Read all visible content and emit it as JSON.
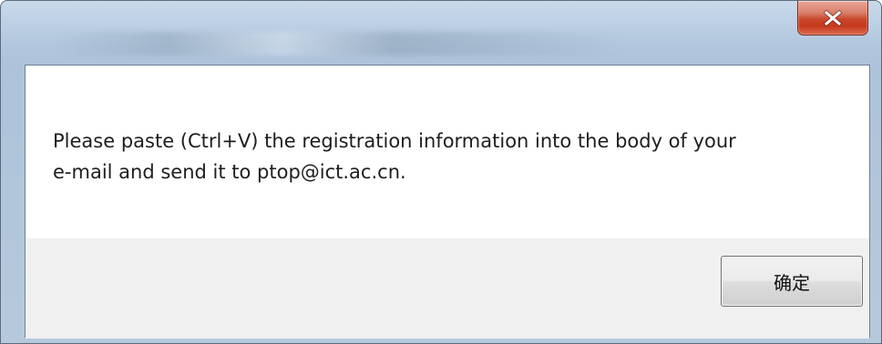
{
  "window": {
    "close_icon": "close-icon"
  },
  "dialog": {
    "message": "Please paste (Ctrl+V) the registration information into the body of your\ne-mail and send it to ptop@ict.ac.cn.",
    "ok_label": "确定"
  },
  "colors": {
    "close_button": "#c7391f",
    "button_area_bg": "#f0f0f0",
    "frame": "#bfd2e6"
  }
}
